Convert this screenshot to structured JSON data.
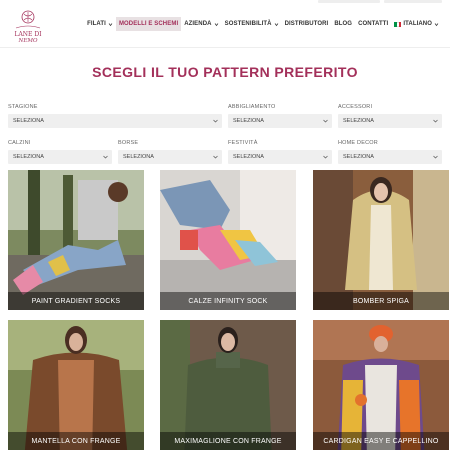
{
  "brand": {
    "name": "LANE DI NEMO",
    "accent": "#a3305a"
  },
  "nav": {
    "items": [
      {
        "label": "FILATI",
        "has_dropdown": true
      },
      {
        "label": "MODELLI E SCHEMI",
        "has_dropdown": false,
        "active": true
      },
      {
        "label": "AZIENDA",
        "has_dropdown": true
      },
      {
        "label": "SOSTENIBILITÀ",
        "has_dropdown": true
      },
      {
        "label": "DISTRIBUTORI",
        "has_dropdown": false
      },
      {
        "label": "BLOG",
        "has_dropdown": false
      },
      {
        "label": "CONTATTI",
        "has_dropdown": false
      }
    ],
    "language": {
      "label": "ITALIANO",
      "flag": "italy-flag-icon"
    }
  },
  "page": {
    "title": "SCEGLI IL TUO PATTERN PREFERITO"
  },
  "filters": [
    {
      "label": "STAGIONE",
      "value": "SELEZIONA"
    },
    {
      "label": "ABBIGLIAMENTO",
      "value": "SELEZIONA"
    },
    {
      "label": "ACCESSORI",
      "value": "SELEZIONA"
    },
    {
      "label": "CALZINI",
      "value": "SELEZIONA"
    },
    {
      "label": "BORSE",
      "value": "SELEZIONA"
    },
    {
      "label": "FESTIVITÀ",
      "value": "SELEZIONA"
    },
    {
      "label": "HOME DECOR",
      "value": "SELEZIONA"
    }
  ],
  "patterns": [
    {
      "title": "PAINT GRADIENT SOCKS"
    },
    {
      "title": "CALZE INFINITY SOCK"
    },
    {
      "title": "BOMBER SPIGA"
    },
    {
      "title": "MANTELLA CON FRANGE"
    },
    {
      "title": "MAXIMAGLIONE CON FRANGE"
    },
    {
      "title": "CARDIGAN EASY E CAPPELLINO"
    }
  ]
}
